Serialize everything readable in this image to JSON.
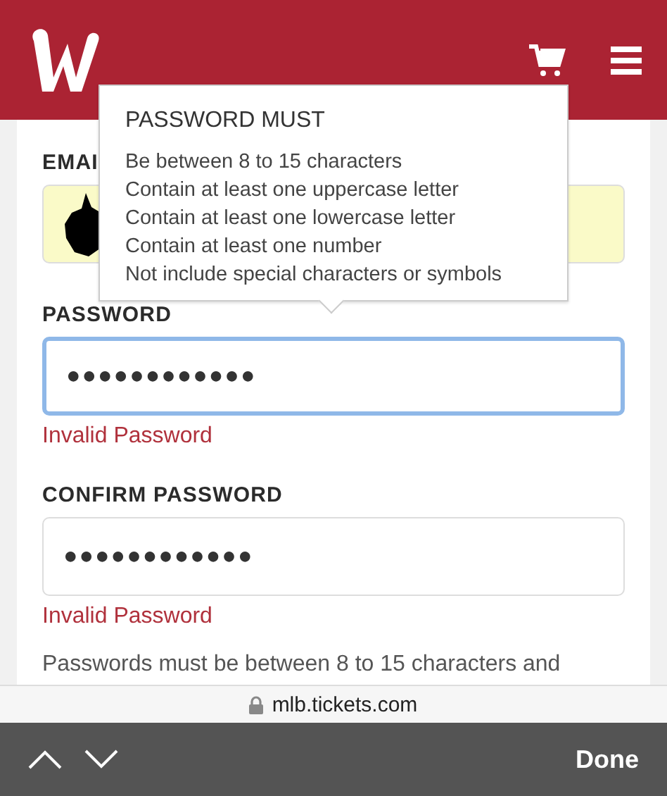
{
  "tooltip": {
    "title": "PASSWORD MUST",
    "rules": [
      "Be between 8 to 15 characters",
      "Contain at least one uppercase letter",
      "Contain at least one lowercase letter",
      "Contain at least one number",
      "Not include special characters or symbols"
    ]
  },
  "email": {
    "label": "EMAI",
    "autofilled": true,
    "redacted": true
  },
  "passwords": [
    {
      "label": "PASSWORD",
      "focused": true,
      "value": "●●●●●●●●●●●●",
      "error": "Invalid Password"
    },
    {
      "label": "CONFIRM PASSWORD",
      "focused": false,
      "value": "●●●●●●●●●●●●",
      "error": "Invalid Password"
    }
  ],
  "hint": "Passwords must be between 8 to 15 characters and",
  "url_bar": {
    "address": "mlb.tickets.com"
  },
  "keyboard_toolbar": {
    "done": "Done"
  }
}
